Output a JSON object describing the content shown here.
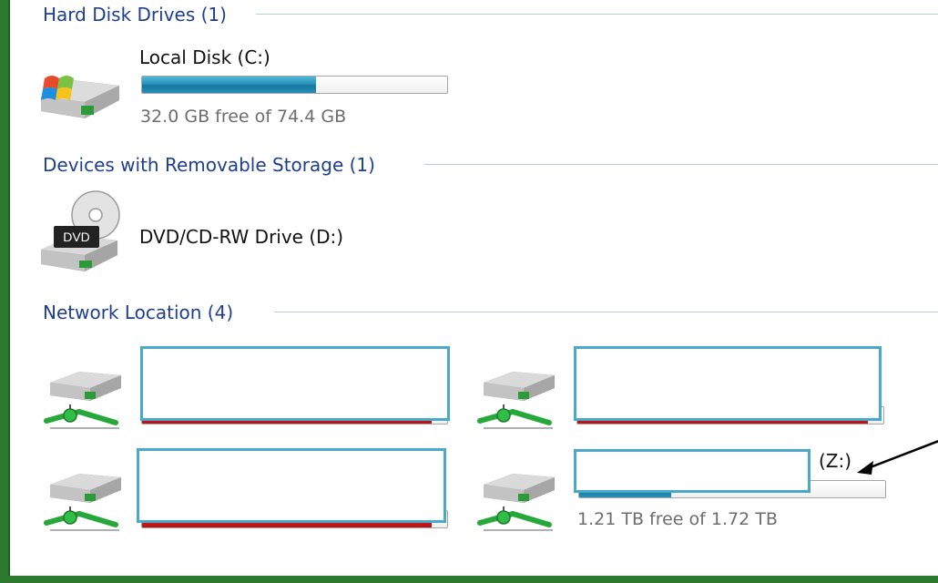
{
  "groups": {
    "hard_disk": {
      "label": "Hard Disk Drives (1)"
    },
    "removable": {
      "label": "Devices with Removable Storage (1)"
    },
    "network": {
      "label": "Network Location (4)"
    }
  },
  "drives": {
    "local_c": {
      "name": "Local Disk (C:)",
      "free_text": "32.0 GB free of 74.4 GB",
      "used_fraction": 0.57,
      "bar_color": "blue"
    },
    "dvd_d": {
      "name": "DVD/CD-RW Drive (D:)",
      "icon_label": "DVD"
    },
    "network_items": [
      {
        "name": "",
        "used_fraction": 0.95,
        "bar_color": "red"
      },
      {
        "name": "",
        "used_fraction": 0.95,
        "bar_color": "red"
      },
      {
        "name": "",
        "used_fraction": 0.95,
        "bar_color": "red"
      },
      {
        "name_suffix": "(Z:)",
        "free_text": "1.21 TB free of 1.72 TB",
        "used_fraction": 0.3,
        "bar_color": "blue"
      }
    ]
  },
  "colors": {
    "background_frame": "#2d7a2f",
    "group_header": "#1e3f8f",
    "redaction_border": "#4aa8c8",
    "bar_blue": "#1f86b3",
    "bar_red": "#cc1a1a",
    "annotation_arrow": "#000000"
  },
  "icons": {
    "hard_drive": "windows-hard-drive-icon",
    "dvd_drive": "dvd-drive-icon",
    "network_drive": "network-drive-icon",
    "arrow": "annotation-arrow-icon"
  }
}
